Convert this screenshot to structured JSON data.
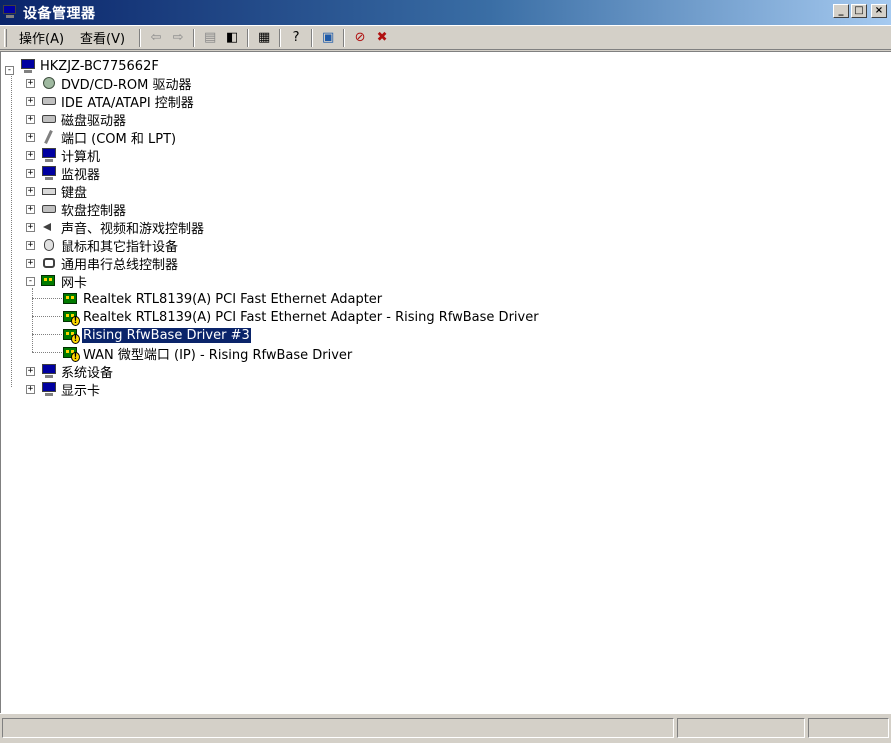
{
  "window": {
    "title": "设备管理器",
    "controls": {
      "minimize": "_",
      "maximize": "□",
      "close": "×"
    }
  },
  "menu": {
    "action": "操作(A)",
    "view": "查看(V)"
  },
  "toolbar": {
    "icons": [
      "back-icon",
      "forward-icon",
      "up-folder-icon",
      "show-hide-tree-icon",
      "properties-icon",
      "help-icon",
      "scan-hardware-icon",
      "disable-device-icon",
      "uninstall-device-icon"
    ]
  },
  "tree": {
    "root": "HKZJZ-BC775662F",
    "categories": [
      {
        "label": "DVD/CD-ROM 驱动器",
        "icon": "cdrom-icon"
      },
      {
        "label": "IDE ATA/ATAPI 控制器",
        "icon": "ide-controller-icon"
      },
      {
        "label": "磁盘驱动器",
        "icon": "disk-drive-icon"
      },
      {
        "label": "端口 (COM 和 LPT)",
        "icon": "port-icon"
      },
      {
        "label": "计算机",
        "icon": "computer-icon"
      },
      {
        "label": "监视器",
        "icon": "monitor-icon"
      },
      {
        "label": "键盘",
        "icon": "keyboard-icon"
      },
      {
        "label": "软盘控制器",
        "icon": "floppy-controller-icon"
      },
      {
        "label": "声音、视频和游戏控制器",
        "icon": "sound-icon"
      },
      {
        "label": "鼠标和其它指针设备",
        "icon": "mouse-icon"
      },
      {
        "label": "通用串行总线控制器",
        "icon": "usb-icon"
      },
      {
        "label": "网卡",
        "icon": "network-card-icon"
      }
    ],
    "network_devices": [
      {
        "label": "Realtek RTL8139(A) PCI Fast Ethernet Adapter",
        "warning": false
      },
      {
        "label": "Realtek RTL8139(A) PCI Fast Ethernet Adapter - Rising RfwBase Driver",
        "warning": true
      },
      {
        "label": "Rising RfwBase Driver #3",
        "warning": true,
        "selected": true
      },
      {
        "label": "WAN 微型端口 (IP) - Rising RfwBase Driver",
        "warning": true
      }
    ],
    "after": [
      {
        "label": "系统设备",
        "icon": "system-devices-icon"
      },
      {
        "label": "显示卡",
        "icon": "display-adapter-icon"
      }
    ]
  }
}
